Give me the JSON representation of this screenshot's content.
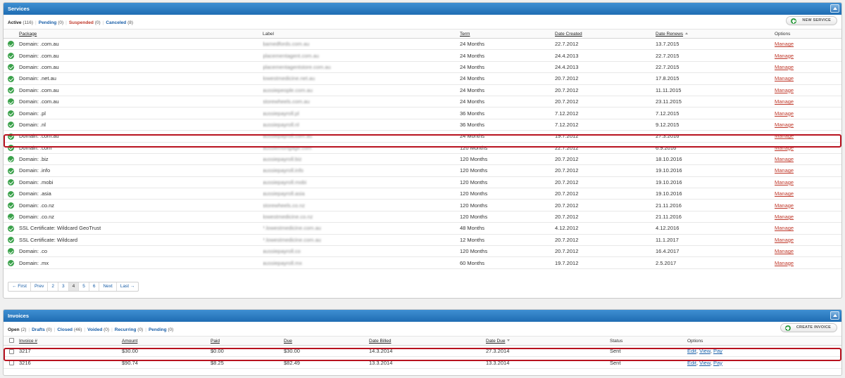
{
  "services": {
    "title": "Services",
    "filters": [
      {
        "label": "Active",
        "count": "(116)",
        "color": "dark"
      },
      {
        "label": "Pending",
        "count": "(0)",
        "color": "blue"
      },
      {
        "label": "Suspended",
        "count": "(0)",
        "color": "red"
      },
      {
        "label": "Canceled",
        "count": "(8)",
        "color": "blue"
      }
    ],
    "new_button": "NEW SERVICE",
    "columns": {
      "package": "Package",
      "label": "Label",
      "term": "Term",
      "created": "Date Created",
      "renews": "Date Renews",
      "options": "Options"
    },
    "rows": [
      {
        "package": "Domain: .com.au",
        "label": "bamedfords.com.au",
        "term": "24 Months",
        "created": "22.7.2012",
        "renews": "13.7.2015",
        "manage": "Manage"
      },
      {
        "package": "Domain: .com.au",
        "label": "placementagent.com.au",
        "term": "24 Months",
        "created": "24.4.2013",
        "renews": "22.7.2015",
        "manage": "Manage"
      },
      {
        "package": "Domain: .com.au",
        "label": "placementagentstore.com.au",
        "term": "24 Months",
        "created": "24.4.2013",
        "renews": "22.7.2015",
        "manage": "Manage"
      },
      {
        "package": "Domain: .net.au",
        "label": "lowestmedicine.net.au",
        "term": "24 Months",
        "created": "20.7.2012",
        "renews": "17.8.2015",
        "manage": "Manage"
      },
      {
        "package": "Domain: .com.au",
        "label": "aussiepeople.com.au",
        "term": "24 Months",
        "created": "20.7.2012",
        "renews": "11.11.2015",
        "manage": "Manage"
      },
      {
        "package": "Domain: .com.au",
        "label": "storewheels.com.au",
        "term": "24 Months",
        "created": "20.7.2012",
        "renews": "23.11.2015",
        "manage": "Manage"
      },
      {
        "package": "Domain: .pl",
        "label": "aussiepayroll.pl",
        "term": "36 Months",
        "created": "7.12.2012",
        "renews": "7.12.2015",
        "manage": "Manage"
      },
      {
        "package": "Domain: .nl",
        "label": "aussiepayroll.nl",
        "term": "36 Months",
        "created": "7.12.2012",
        "renews": "9.12.2015",
        "manage": "Manage"
      },
      {
        "package": "Domain: .com.au",
        "label": "aussiepayroll.com.au",
        "term": "24 Months",
        "created": "19.7.2012",
        "renews": "27.3.2016",
        "manage": "Manage"
      },
      {
        "package": "Domain: .com",
        "label": "aussiemortgage.com",
        "term": "120 Months",
        "created": "22.7.2012",
        "renews": "6.9.2016",
        "manage": "Manage"
      },
      {
        "package": "Domain: .biz",
        "label": "aussiepayroll.biz",
        "term": "120 Months",
        "created": "20.7.2012",
        "renews": "18.10.2016",
        "manage": "Manage"
      },
      {
        "package": "Domain: .info",
        "label": "aussiepayroll.info",
        "term": "120 Months",
        "created": "20.7.2012",
        "renews": "19.10.2016",
        "manage": "Manage"
      },
      {
        "package": "Domain: .mobi",
        "label": "aussiepayroll.mobi",
        "term": "120 Months",
        "created": "20.7.2012",
        "renews": "19.10.2016",
        "manage": "Manage"
      },
      {
        "package": "Domain: .asia",
        "label": "aussiepayroll.asia",
        "term": "120 Months",
        "created": "20.7.2012",
        "renews": "19.10.2016",
        "manage": "Manage"
      },
      {
        "package": "Domain: .co.nz",
        "label": "storewheels.co.nz",
        "term": "120 Months",
        "created": "20.7.2012",
        "renews": "21.11.2016",
        "manage": "Manage"
      },
      {
        "package": "Domain: .co.nz",
        "label": "lowestmedicine.co.nz",
        "term": "120 Months",
        "created": "20.7.2012",
        "renews": "21.11.2016",
        "manage": "Manage"
      },
      {
        "package": "SSL Certificate: Wildcard GeoTrust",
        "label": "*.lowestmedicine.com.au",
        "term": "48 Months",
        "created": "4.12.2012",
        "renews": "4.12.2016",
        "manage": "Manage"
      },
      {
        "package": "SSL Certificate: Wildcard",
        "label": "*.lowestmedicine.com.au",
        "term": "12 Months",
        "created": "20.7.2012",
        "renews": "11.1.2017",
        "manage": "Manage"
      },
      {
        "package": "Domain: .co",
        "label": "aussiepayroll.co",
        "term": "120 Months",
        "created": "20.7.2012",
        "renews": "16.4.2017",
        "manage": "Manage"
      },
      {
        "package": "Domain: .mx",
        "label": "aussiepayroll.mx",
        "term": "60 Months",
        "created": "19.7.2012",
        "renews": "2.5.2017",
        "manage": "Manage"
      }
    ],
    "pagination": [
      "← First",
      "Prev",
      "2",
      "3",
      "4",
      "5",
      "6",
      "Next",
      "Last →"
    ],
    "current_page": "4"
  },
  "invoices": {
    "title": "Invoices",
    "filters": [
      {
        "label": "Open",
        "count": "(2)",
        "color": "dark"
      },
      {
        "label": "Drafts",
        "count": "(0)",
        "color": "blue"
      },
      {
        "label": "Closed",
        "count": "(46)",
        "color": "blue"
      },
      {
        "label": "Voided",
        "count": "(0)",
        "color": "blue"
      },
      {
        "label": "Recurring",
        "count": "(0)",
        "color": "blue"
      },
      {
        "label": "Pending",
        "count": "(0)",
        "color": "blue"
      }
    ],
    "create_button": "CREATE INVOICE",
    "columns": {
      "invoice": "Invoice #",
      "amount": "Amount",
      "paid": "Paid",
      "due": "Due",
      "billed": "Date Billed",
      "date_due": "Date Due",
      "status": "Status",
      "options": "Options"
    },
    "rows": [
      {
        "invoice": "3217",
        "amount": "$30.00",
        "paid": "$0.00",
        "due": "$30.00",
        "billed": "14.3.2014",
        "date_due": "27.3.2014",
        "status": "Sent",
        "edit": "Edit",
        "view": "View",
        "pay": "Pay"
      },
      {
        "invoice": "3216",
        "amount": "$90.74",
        "paid": "$8.25",
        "due": "$82.49",
        "billed": "13.3.2014",
        "date_due": "13.3.2014",
        "status": "Sent",
        "edit": "Edit",
        "view": "View",
        "pay": "Pay"
      }
    ]
  },
  "colors": {
    "header_blue": "#1f6db3",
    "active_green": "#3aa14a",
    "highlight_red": "#b8121f",
    "link_blue": "#1a5fa8",
    "manage_red": "#c0392b"
  }
}
